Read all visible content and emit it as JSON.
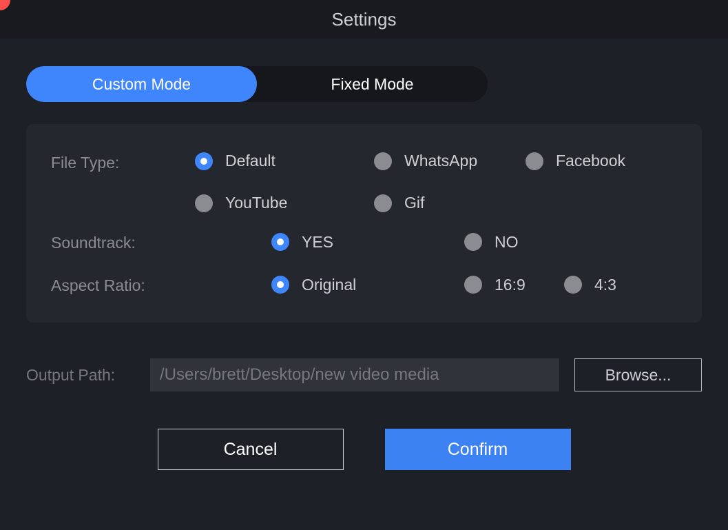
{
  "title": "Settings",
  "tabs": {
    "custom": "Custom Mode",
    "fixed": "Fixed Mode",
    "active": "custom"
  },
  "filetype": {
    "label": "File Type:",
    "options": {
      "default": "Default",
      "whatsapp": "WhatsApp",
      "facebook": "Facebook",
      "youtube": "YouTube",
      "gif": "Gif"
    },
    "selected": "default"
  },
  "soundtrack": {
    "label": "Soundtrack:",
    "options": {
      "yes": "YES",
      "no": "NO"
    },
    "selected": "yes"
  },
  "aspect": {
    "label": "Aspect Ratio:",
    "options": {
      "original": "Original",
      "16_9": "16:9",
      "4_3": "4:3"
    },
    "selected": "original"
  },
  "output": {
    "label": "Output Path:",
    "value": "/Users/brett/Desktop/new video media",
    "browse": "Browse..."
  },
  "buttons": {
    "cancel": "Cancel",
    "confirm": "Confirm"
  }
}
